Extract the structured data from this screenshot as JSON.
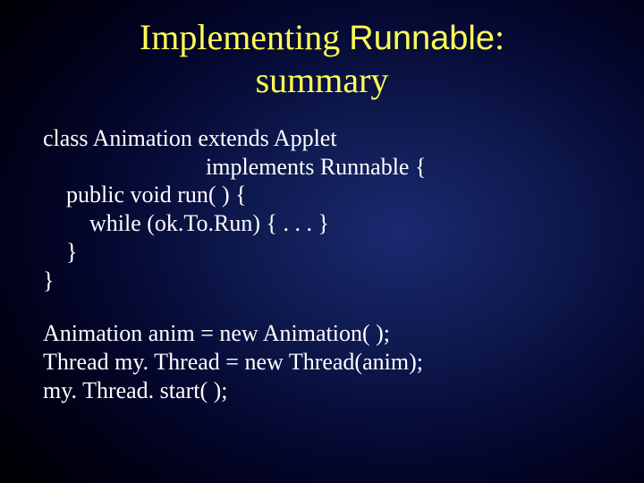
{
  "title": {
    "line1_pre": "Implementing ",
    "line1_mono": "Runnable",
    "line1_post": ":",
    "line2": "summary"
  },
  "code": {
    "l1": "class Animation extends Applet",
    "l2": "                            implements Runnable {",
    "l3": "    public void run( ) {",
    "l4": "        while (ok.To.Run) { . . . }",
    "l5": "    }",
    "l6": "}",
    "u1": "Animation anim = new Animation( );",
    "u2": "Thread my. Thread = new Thread(anim);",
    "u3": "my. Thread. start( );"
  }
}
